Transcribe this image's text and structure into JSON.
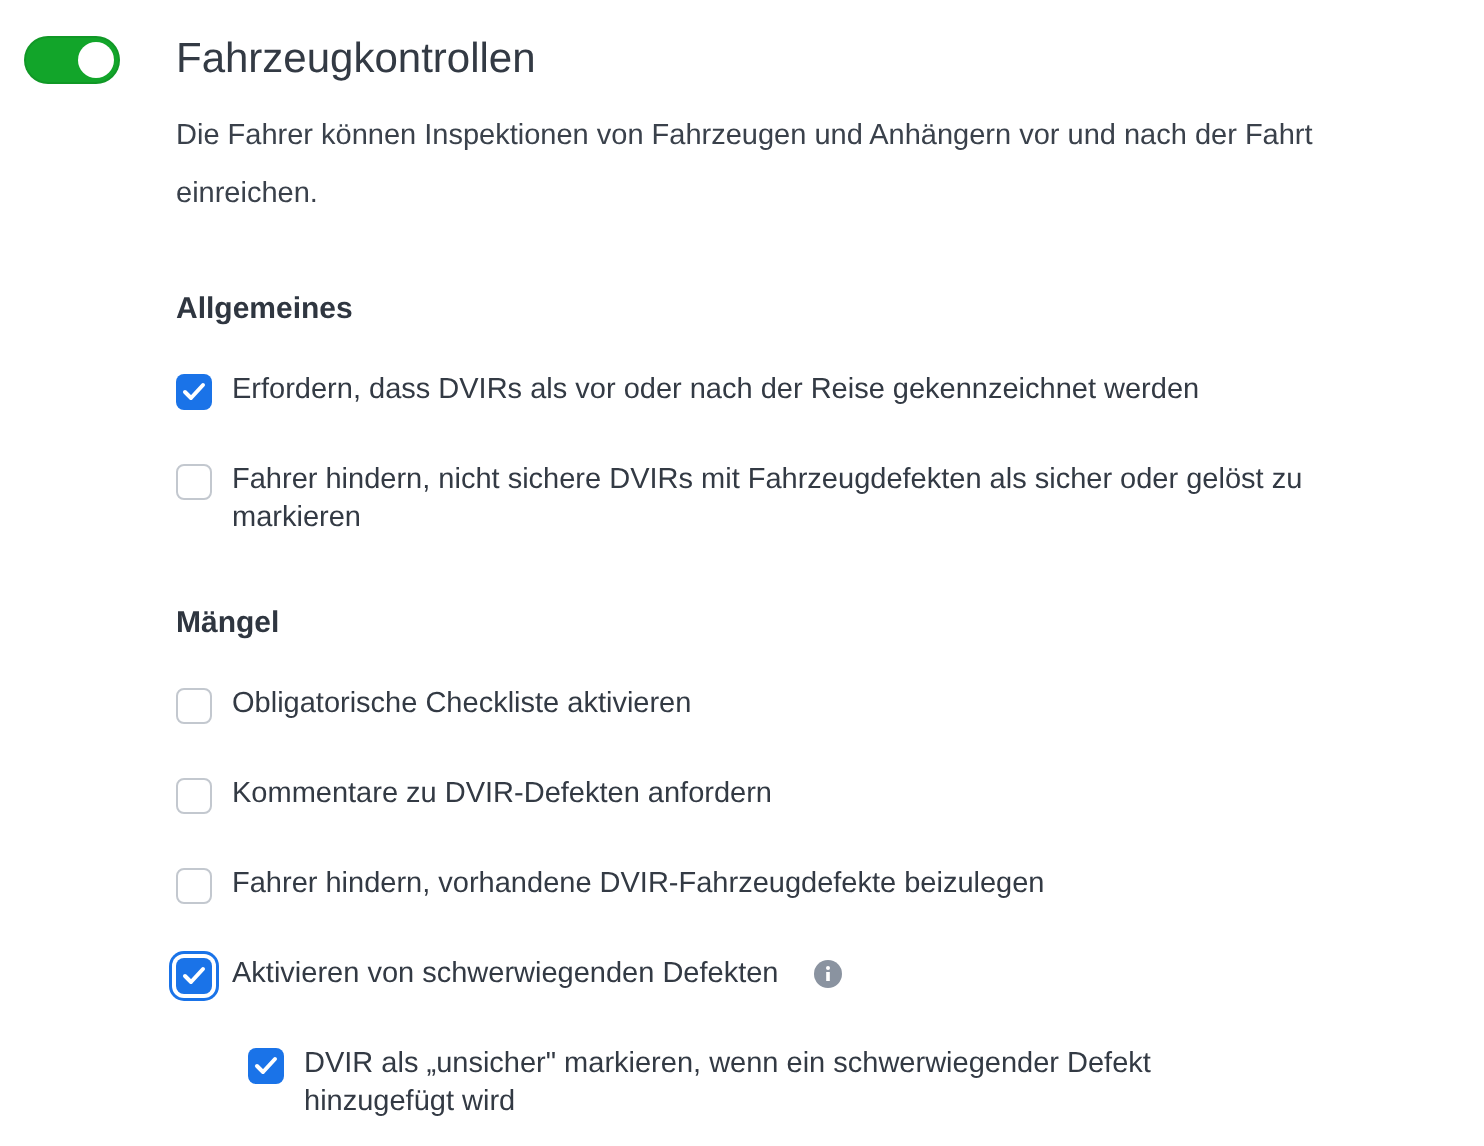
{
  "toggle": {
    "on": true
  },
  "title": "Fahrzeugkontrollen",
  "description": "Die Fahrer können Inspektionen von Fahrzeugen und Anhängern vor und nach der Fahrt einreichen.",
  "sections": [
    {
      "heading": "Allgemeines",
      "options": [
        {
          "label": "Erfordern, dass DVIRs als vor oder nach der Reise gekennzeichnet werden",
          "checked": true,
          "focused": false
        },
        {
          "label": "Fahrer hindern, nicht sichere DVIRs mit Fahrzeugdefekten als sicher oder gelöst zu markieren",
          "checked": false,
          "focused": false
        }
      ]
    },
    {
      "heading": "Mängel",
      "options": [
        {
          "label": "Obligatorische Checkliste aktivieren",
          "checked": false,
          "focused": false
        },
        {
          "label": "Kommentare zu DVIR-Defekten anfordern",
          "checked": false,
          "focused": false
        },
        {
          "label": "Fahrer hindern, vorhandene DVIR-Fahrzeugdefekte beizulegen",
          "checked": false,
          "focused": false
        },
        {
          "label": "Aktivieren von schwerwiegenden Defekten",
          "checked": true,
          "focused": true,
          "info": true,
          "children": [
            {
              "label": "DVIR als „unsicher\" markieren, wenn ein schwerwiegender Defekt hinzugefügt wird",
              "checked": true,
              "focused": false
            }
          ]
        }
      ]
    }
  ]
}
